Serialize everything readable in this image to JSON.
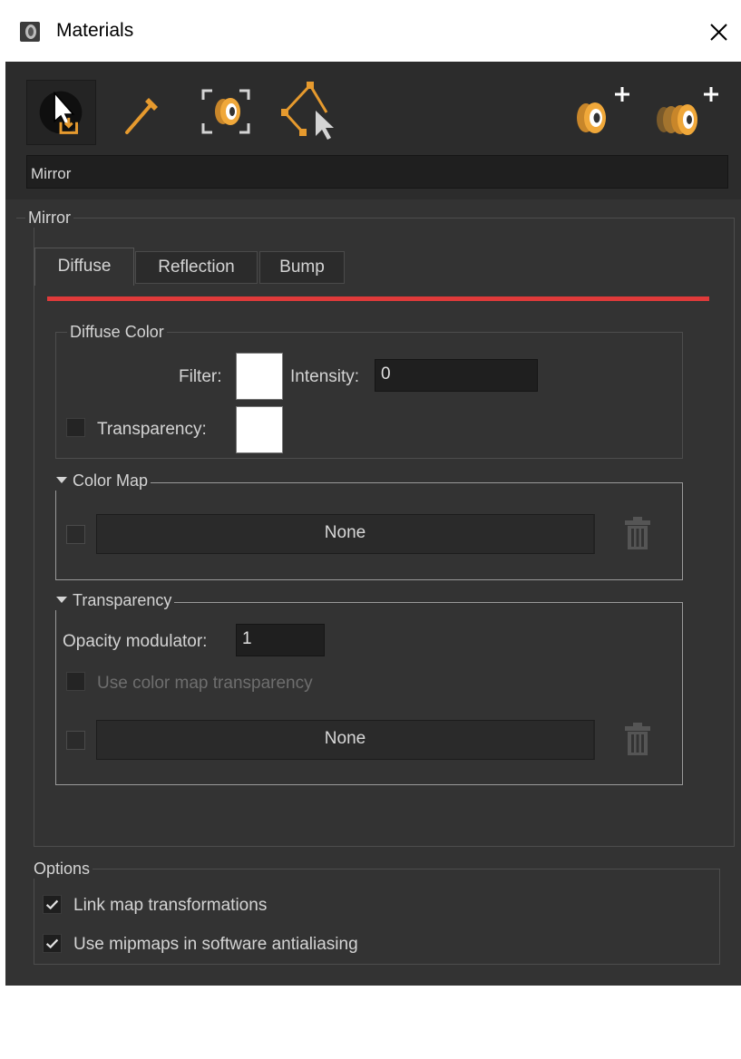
{
  "window": {
    "title": "Materials"
  },
  "toolbar": {
    "icons": [
      "select-material-icon",
      "eyedropper-icon",
      "scene-material-icon",
      "select-by-material-icon",
      "add-material-icon",
      "add-multiple-materials-icon"
    ]
  },
  "material_name": "Mirror",
  "material_group_title": "Mirror",
  "tabs": [
    {
      "label": "Diffuse",
      "active": true
    },
    {
      "label": "Reflection",
      "active": false
    },
    {
      "label": "Bump",
      "active": false
    }
  ],
  "accent_color": "#e03a3a",
  "diffuse_color": {
    "title": "Diffuse Color",
    "filter_label": "Filter:",
    "filter_color": "#ffffff",
    "intensity_label": "Intensity:",
    "intensity_value": "0",
    "transparency_label": "Transparency:",
    "transparency_checked": false,
    "transparency_color": "#ffffff"
  },
  "color_map": {
    "title": "Color Map",
    "enabled": false,
    "map_label": "None"
  },
  "transparency": {
    "title": "Transparency",
    "opacity_label": "Opacity modulator:",
    "opacity_value": "1",
    "use_color_map_label": "Use color map transparency",
    "use_color_map_checked": false,
    "enabled": false,
    "map_label": "None"
  },
  "options": {
    "title": "Options",
    "link_map_label": "Link map transformations",
    "link_map_checked": true,
    "mipmaps_label": "Use mipmaps in software antialiasing",
    "mipmaps_checked": true
  }
}
